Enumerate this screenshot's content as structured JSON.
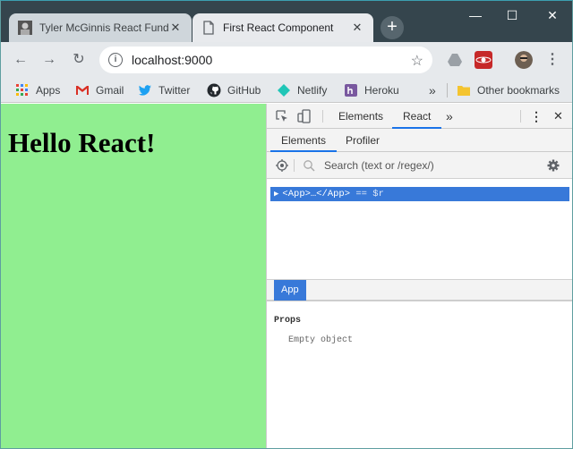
{
  "tabs": [
    {
      "title": "Tyler McGinnis React Fund",
      "active": false
    },
    {
      "title": "First React Component",
      "active": true
    }
  ],
  "window_controls": {
    "minimize": "—",
    "maximize": "☐",
    "close": "✕"
  },
  "toolbar": {
    "url": "localhost:9000"
  },
  "bookmarks": [
    {
      "label": "Apps",
      "icon": "apps-grid-icon"
    },
    {
      "label": "Gmail",
      "icon": "gmail-icon"
    },
    {
      "label": "Twitter",
      "icon": "twitter-icon"
    },
    {
      "label": "GitHub",
      "icon": "github-icon"
    },
    {
      "label": "Netlify",
      "icon": "netlify-icon"
    },
    {
      "label": "Heroku",
      "icon": "heroku-icon"
    }
  ],
  "bookmarks_overflow": "»",
  "other_bookmarks": "Other bookmarks",
  "page": {
    "heading": "Hello React!",
    "background": "#90ee90"
  },
  "devtools": {
    "tabs": [
      "Elements",
      "React"
    ],
    "active_tab": "React",
    "overflow": "»",
    "subtabs": [
      "Elements",
      "Profiler"
    ],
    "active_subtab": "Elements",
    "search_placeholder": "Search (text or /regex/)",
    "tree_row": "<App>…</App>",
    "tree_row_suffix": "== $r",
    "selected_component": "App",
    "props_heading": "Props",
    "props_empty": "Empty object",
    "accent_color": "#3879d9"
  }
}
